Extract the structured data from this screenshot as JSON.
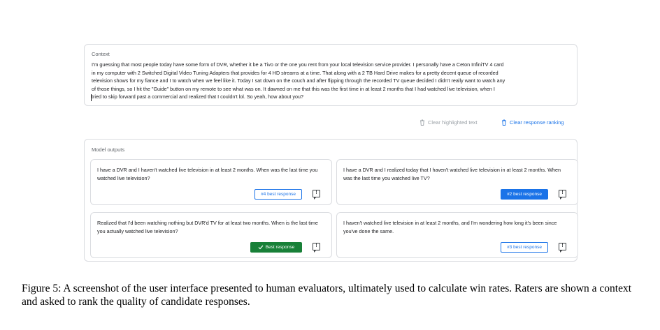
{
  "context": {
    "label": "Context",
    "lines": [
      "I'm guessing that most people today have some form of DVR, whether it be a Tivo or the one you rent from your local television service provider. I personally have a Ceton InfiniTV 4 card",
      "in my computer with 2 Switched Digital Video Tuning Adapters that provides for 4 HD streams at a time. That along with a 2 TB Hard Drive makes for a pretty decent queue of recorded",
      "television shows for my fiance and I to watch when we feel like it. Today I sat down on the couch and after flipping through the recorded TV queue decided I didn't really want to watch any",
      "of those things, so I hit the \"Guide\" button on my remote to see what was on. It dawned on me that this was the first time in at least 2 months that I had watched live television, when I",
      "tried to skip forward past a commercial and realized that I couldn't lol. So yeah, how about you?"
    ]
  },
  "actions": {
    "clear_highlighted": "Clear highlighted text",
    "clear_ranking": "Clear response ranking"
  },
  "outputs": {
    "label": "Model outputs",
    "cards": [
      {
        "text": "I have a DVR and I haven't watched live television in at least 2 months. When was the last time you watched live television?",
        "rank_label": "#4 best response",
        "rank_style": "outline"
      },
      {
        "text": "I have a DVR and I realized today that I haven't watched live television in at least 2 months. When was the last time you watched live TV?",
        "rank_label": "#2 best response",
        "rank_style": "blue"
      },
      {
        "text": "Realized that I'd been watching nothing but DVR'd TV for at least two months. When is the last time you actually watched live television?",
        "rank_label": "Best response",
        "rank_style": "green"
      },
      {
        "text": "I haven't watched live television in at least 2 months, and I'm wondering how long it's been since you've done the same.",
        "rank_label": "#3 best response",
        "rank_style": "outline"
      }
    ]
  },
  "colors": {
    "accent_blue": "#1a73e8",
    "best_green": "#188038",
    "border": "#dadce0",
    "muted": "#9aa0a6"
  },
  "icons": {
    "trash": "trash-icon",
    "check": "check-icon",
    "flag": "report-flag-icon"
  },
  "caption": "Figure 5: A screenshot of the user interface presented to human evaluators, ultimately used to calculate win rates. Raters are shown a context and asked to rank the quality of candidate responses."
}
